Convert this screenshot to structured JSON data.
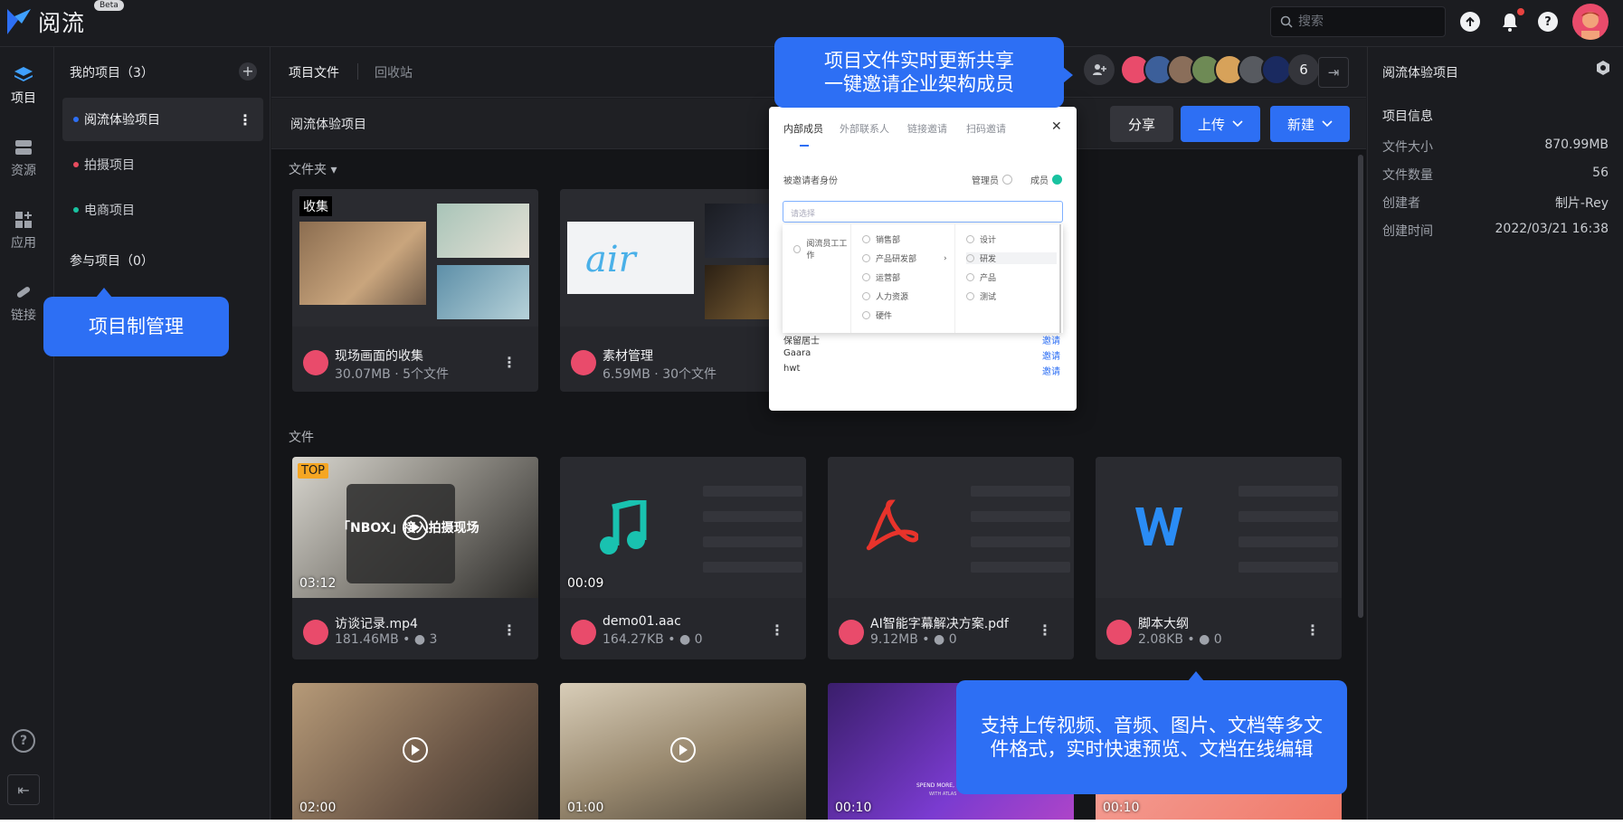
{
  "app": {
    "name": "阅流",
    "beta": "Beta"
  },
  "topbar": {
    "search_placeholder": "搜索",
    "help": "?"
  },
  "rail": {
    "items": [
      {
        "label": "项目",
        "icon": "layers-icon"
      },
      {
        "label": "资源",
        "icon": "database-icon"
      },
      {
        "label": "应用",
        "icon": "apps-icon"
      },
      {
        "label": "链接",
        "icon": "link-icon"
      }
    ],
    "help": "?",
    "collapse": "⇤"
  },
  "projects": {
    "my_projects": "我的项目（3）",
    "joined_projects": "参与项目（0）",
    "items": [
      {
        "label": "阅流体验项目",
        "color": "#2d6ff4"
      },
      {
        "label": "拍摄项目",
        "color": "#e84c5e"
      },
      {
        "label": "电商项目",
        "color": "#19c2a0"
      }
    ]
  },
  "callouts": {
    "project_mgmt": "项目制管理",
    "share_line1": "项目文件实时更新共享",
    "share_line2": "一键邀请企业架构成员",
    "upload_line1": "支持上传视频、音频、图片、文档等多文",
    "upload_line2": "件格式，实时快速预览、文档在线编辑"
  },
  "main": {
    "tabs": [
      "项目文件",
      "回收站"
    ],
    "member_count": "6",
    "breadcrumb": "阅流体验项目",
    "share_btn": "分享",
    "upload_btn": "上传",
    "new_btn": "新建",
    "folder_section": "文件夹",
    "file_section": "文件"
  },
  "folders": [
    {
      "tag": "收集",
      "name": "现场画面的收集",
      "sub": "30.07MB · 5个文件"
    },
    {
      "name": "素材管理",
      "sub": "6.59MB · 30个文件"
    }
  ],
  "files": [
    {
      "name": "访谈记录.mp4",
      "size": "181.46MB",
      "comments": "3",
      "duration": "03:12",
      "tag": "TOP",
      "overlay": "「NBOX」接入拍摄现场"
    },
    {
      "name": "demo01.aac",
      "size": "164.27KB",
      "comments": "0",
      "duration": "00:09"
    },
    {
      "name": "AI智能字幕解决方案.pdf",
      "size": "9.12MB",
      "comments": "0"
    },
    {
      "name": "脚本大纲",
      "size": "2.08KB",
      "comments": "0"
    }
  ],
  "bottom_durations": [
    "02:00",
    "01:00",
    "00:10",
    "00:10"
  ],
  "bottom_texts": {
    "promo": "SPEND MORE, EXPLORE",
    "brand": "WITH ATLAS"
  },
  "info": {
    "title": "阅流体验项目",
    "section": "项目信息",
    "rows": [
      {
        "k": "文件大小",
        "v": "870.99MB"
      },
      {
        "k": "文件数量",
        "v": "56"
      },
      {
        "k": "创建者",
        "v": "制片-Rey"
      },
      {
        "k": "创建时间",
        "v": "2022/03/21 16:38"
      }
    ]
  },
  "modal": {
    "tabs": [
      "内部成员",
      "外部联系人",
      "链接邀请",
      "扫码邀请"
    ],
    "role_label": "被邀请者身份",
    "role_admin": "管理员",
    "role_member": "成员",
    "select_placeholder": "请选择",
    "col1": [
      "阅流员工工作"
    ],
    "col2": [
      "销售部",
      "产品研发部",
      "运营部",
      "人力资源",
      "硬件"
    ],
    "col3": [
      "设计",
      "研发",
      "产品",
      "测试"
    ],
    "users": [
      {
        "name": "保留居士",
        "action": "邀请"
      },
      {
        "name": "Gaara",
        "action": "邀请"
      },
      {
        "name": "hwt",
        "action": "邀请"
      }
    ]
  },
  "colors": {
    "accent": "#2d6ff4",
    "bg": "#1b1c20",
    "content_bg": "#141518",
    "card": "#26272c"
  }
}
